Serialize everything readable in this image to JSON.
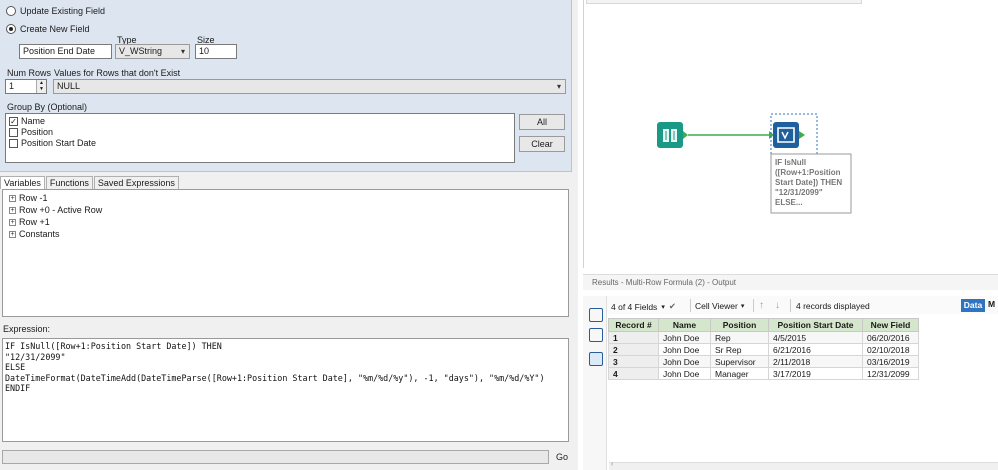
{
  "config": {
    "radio_update": "Update Existing Field",
    "radio_create": "Create New  Field",
    "label_type": "Type",
    "label_size": "Size",
    "field_name_value": "Position End Date",
    "type_value": "V_WString",
    "size_value": "10",
    "label_num_rows": "Num Rows",
    "label_values_missing": "Values for Rows that don't Exist",
    "num_rows_value": "1",
    "missing_value": "NULL",
    "label_group_by": "Group By (Optional)",
    "group_fields": [
      {
        "label": "Name",
        "checked": true
      },
      {
        "label": "Position",
        "checked": false
      },
      {
        "label": "Position Start Date",
        "checked": false
      }
    ],
    "btn_all": "All",
    "btn_clear": "Clear"
  },
  "tabs": [
    "Variables",
    "Functions",
    "Saved Expressions"
  ],
  "variables": [
    "Row -1",
    "Row +0 - Active Row",
    "Row +1",
    "Constants"
  ],
  "expression_label": "Expression:",
  "expression_text": "IF IsNull([Row+1:Position Start Date]) THEN\n\"12/31/2099\"\nELSE\nDateTimeFormat(DateTimeAdd(DateTimeParse([Row+1:Position Start Date], \"%m/%d/%y\"), -1, \"days\"), \"%m/%d/%Y\")\nENDIF",
  "go_label": "Go",
  "canvas": {
    "tool_annotation": [
      "IF IsNull",
      "([Row+1:Position",
      "Start Date]) THEN",
      "\"12/31/2099\"",
      "ELSE..."
    ]
  },
  "results": {
    "title": "Results - Multi-Row Formula (2) - Output",
    "fields_label": "4 of 4 Fields",
    "viewer_label": "Cell Viewer",
    "records_label": "4 records displayed",
    "data_btn": "Data",
    "meta_btn": "M",
    "columns": [
      "Record #",
      "Name",
      "Position",
      "Position Start Date",
      "New Field"
    ],
    "rows": [
      [
        "1",
        "John Doe",
        "Rep",
        "4/5/2015",
        "06/20/2016"
      ],
      [
        "2",
        "John Doe",
        "Sr Rep",
        "6/21/2016",
        "02/10/2018"
      ],
      [
        "3",
        "John Doe",
        "Supervisor",
        "2/11/2018",
        "03/16/2019"
      ],
      [
        "4",
        "John Doe",
        "Manager",
        "3/17/2019",
        "12/31/2099"
      ]
    ]
  },
  "colors": {
    "accent": "#2f74c0",
    "input_tool": "#1a9a86",
    "header_green": "#d4e7cc",
    "connector": "#3fae49"
  }
}
